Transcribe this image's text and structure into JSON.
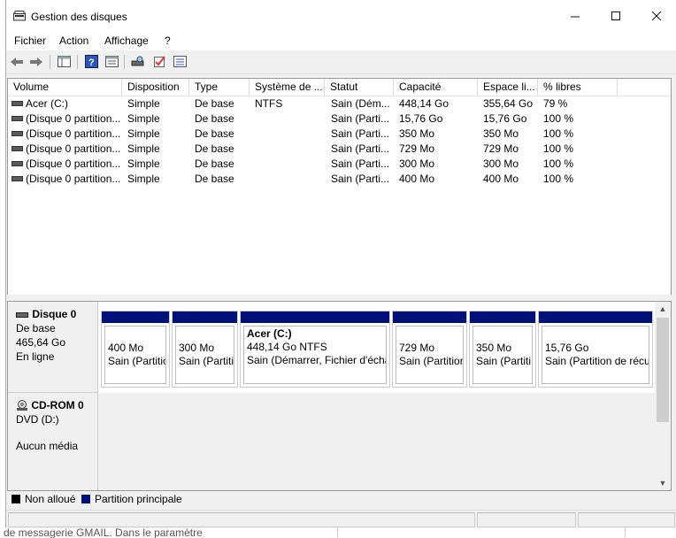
{
  "window": {
    "title": "Gestion des disques"
  },
  "menu": [
    "Fichier",
    "Action",
    "Affichage",
    "?"
  ],
  "columns": [
    "Volume",
    "Disposition",
    "Type",
    "Système de ...",
    "Statut",
    "Capacité",
    "Espace li...",
    "% libres"
  ],
  "volumes": [
    [
      "Acer (C:)",
      "Simple",
      "De base",
      "NTFS",
      "Sain (Dém...",
      "448,14 Go",
      "355,64 Go",
      "79 %"
    ],
    [
      "(Disque 0 partition...",
      "Simple",
      "De base",
      "",
      "Sain (Parti...",
      "15,76 Go",
      "15,76 Go",
      "100 %"
    ],
    [
      "(Disque 0 partition...",
      "Simple",
      "De base",
      "",
      "Sain (Parti...",
      "350 Mo",
      "350 Mo",
      "100 %"
    ],
    [
      "(Disque 0 partition...",
      "Simple",
      "De base",
      "",
      "Sain (Parti...",
      "729 Mo",
      "729 Mo",
      "100 %"
    ],
    [
      "(Disque 0 partition...",
      "Simple",
      "De base",
      "",
      "Sain (Parti...",
      "300 Mo",
      "300 Mo",
      "100 %"
    ],
    [
      "(Disque 0 partition...",
      "Simple",
      "De base",
      "",
      "Sain (Parti...",
      "400 Mo",
      "400 Mo",
      "100 %"
    ]
  ],
  "disk0": {
    "name": "Disque 0",
    "type": "De base",
    "size": "465,64 Go",
    "state": "En ligne",
    "partitions": [
      {
        "title": "",
        "size": "400 Mo",
        "status": "Sain (Partitio"
      },
      {
        "title": "",
        "size": "300 Mo",
        "status": "Sain (Partiti"
      },
      {
        "title": "Acer  (C:)",
        "size": "448,14 Go NTFS",
        "status": "Sain (Démarrer, Fichier d'écha"
      },
      {
        "title": "",
        "size": "729 Mo",
        "status": "Sain (Partition"
      },
      {
        "title": "",
        "size": "350 Mo",
        "status": "Sain (Partiti"
      },
      {
        "title": "",
        "size": "15,76 Go",
        "status": "Sain (Partition de récu"
      }
    ]
  },
  "cdrom": {
    "name": "CD-ROM 0",
    "drive": "DVD (D:)",
    "state": "Aucun média"
  },
  "legend": {
    "unallocated": {
      "label": "Non alloué",
      "color": "#000000"
    },
    "primary": {
      "label": "Partition principale",
      "color": "#00127a"
    }
  },
  "background_text": "de messagerie GMAIL. Dans le paramètre"
}
